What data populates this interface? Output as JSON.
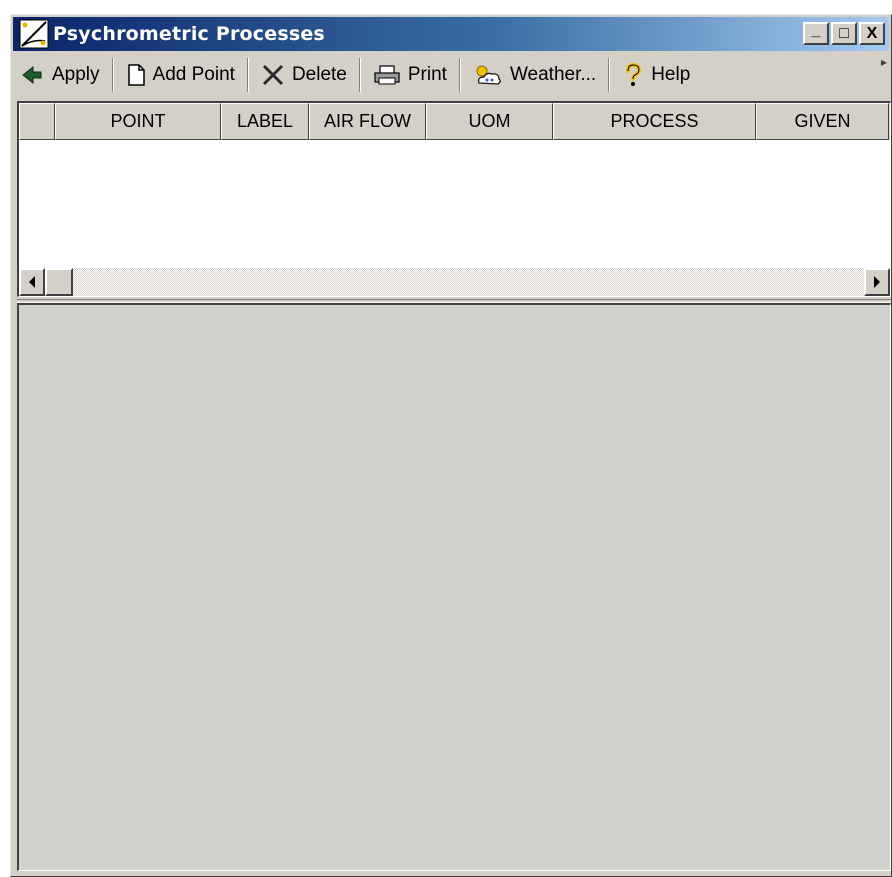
{
  "window": {
    "title": "Psychrometric Processes",
    "app_icon": "psychrometric-chart-icon"
  },
  "title_buttons": {
    "minimize_label": "_",
    "maximize_label": "□",
    "close_label": "X"
  },
  "toolbar": {
    "apply": {
      "label": "Apply",
      "icon": "apply-arrow-icon"
    },
    "add_point": {
      "label": "Add Point",
      "icon": "new-document-icon"
    },
    "delete": {
      "label": "Delete",
      "icon": "delete-x-icon"
    },
    "print": {
      "label": "Print",
      "icon": "printer-icon"
    },
    "weather": {
      "label": "Weather...",
      "icon": "weather-icon"
    },
    "help": {
      "label": "Help",
      "icon": "help-question-icon"
    }
  },
  "table": {
    "columns": [
      "",
      "POINT",
      "LABEL",
      "AIR FLOW",
      "UOM",
      "PROCESS",
      "GIVEN"
    ],
    "rows": []
  },
  "colors": {
    "titlebar_start": "#0a246a",
    "titlebar_end": "#a6caf0",
    "window_face": "#d4d0c8"
  }
}
